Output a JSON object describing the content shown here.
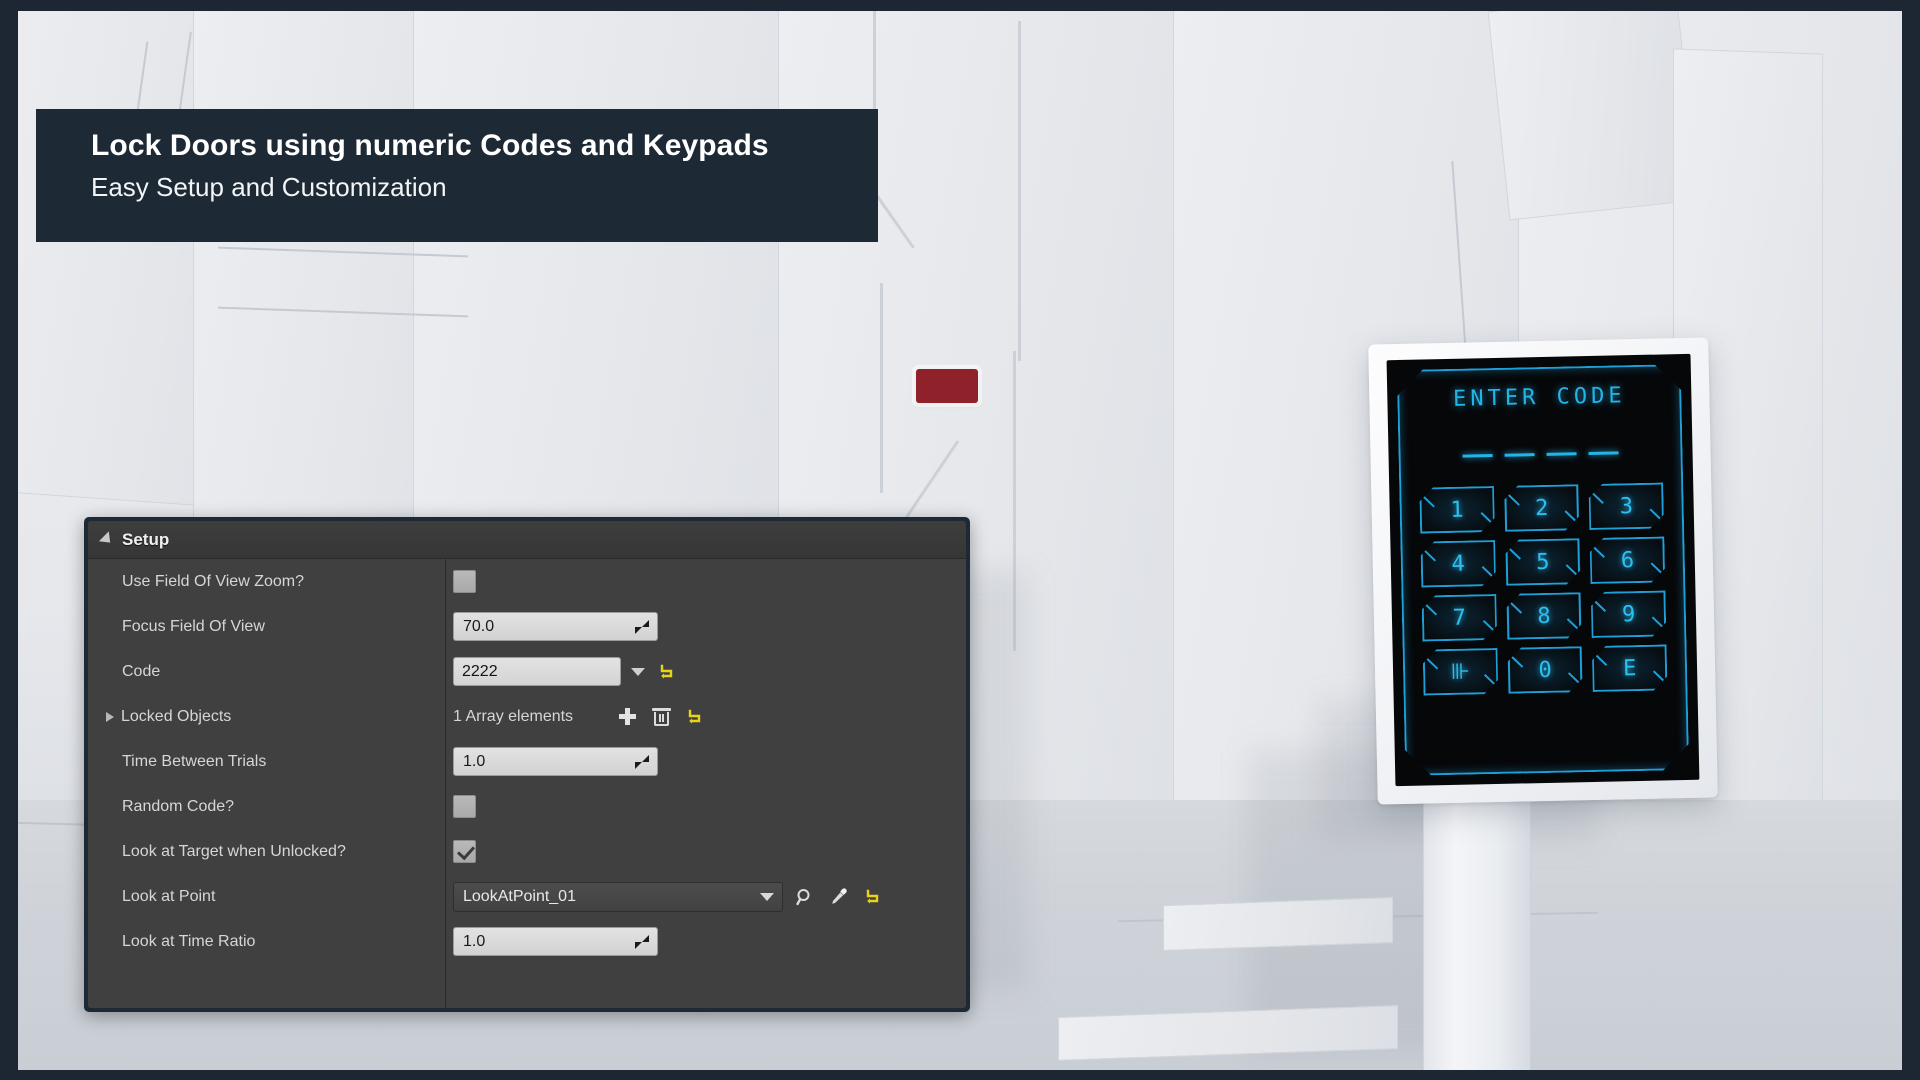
{
  "banner": {
    "title": "Lock Doors using numeric Codes and Keypads",
    "subtitle": "Easy Setup and Customization"
  },
  "keypad": {
    "title": "ENTER CODE",
    "code_placeholder_digits": 4,
    "keys": [
      "1",
      "2",
      "3",
      "4",
      "5",
      "6",
      "7",
      "8",
      "9",
      "⊪",
      "0",
      "E"
    ],
    "accent_color": "#1e9fd8",
    "screen_color": "#060709"
  },
  "details_panel": {
    "section_title": "Setup",
    "rows": [
      {
        "label": "Use Field Of View Zoom?",
        "widget": "checkbox",
        "value": "",
        "checked": false
      },
      {
        "label": "Focus Field Of View",
        "widget": "spinner",
        "value": "70.0"
      },
      {
        "label": "Code",
        "widget": "text-combo",
        "value": "2222",
        "icons": [
          "dropdown-caret",
          "reset-arrow"
        ]
      },
      {
        "label": "Locked Objects",
        "widget": "array",
        "value": "1 Array elements",
        "expandable": true,
        "icons": [
          "add-element",
          "delete-all",
          "reset-arrow"
        ]
      },
      {
        "label": "Time Between Trials",
        "widget": "spinner",
        "value": "1.0"
      },
      {
        "label": "Random Code?",
        "widget": "checkbox",
        "value": "",
        "checked": false
      },
      {
        "label": "Look at Target when Unlocked?",
        "widget": "checkbox",
        "value": "",
        "checked": true
      },
      {
        "label": "Look at Point",
        "widget": "object-combo",
        "value": "LookAtPoint_01",
        "icons": [
          "browse-search",
          "eyedropper",
          "reset-arrow"
        ]
      },
      {
        "label": "Look at Time Ratio",
        "widget": "spinner",
        "value": "1.0"
      }
    ]
  },
  "scene": {
    "red_plate_color": "#8e2129",
    "frame_color": "#1c2733",
    "banner_color": "#1e2936"
  }
}
